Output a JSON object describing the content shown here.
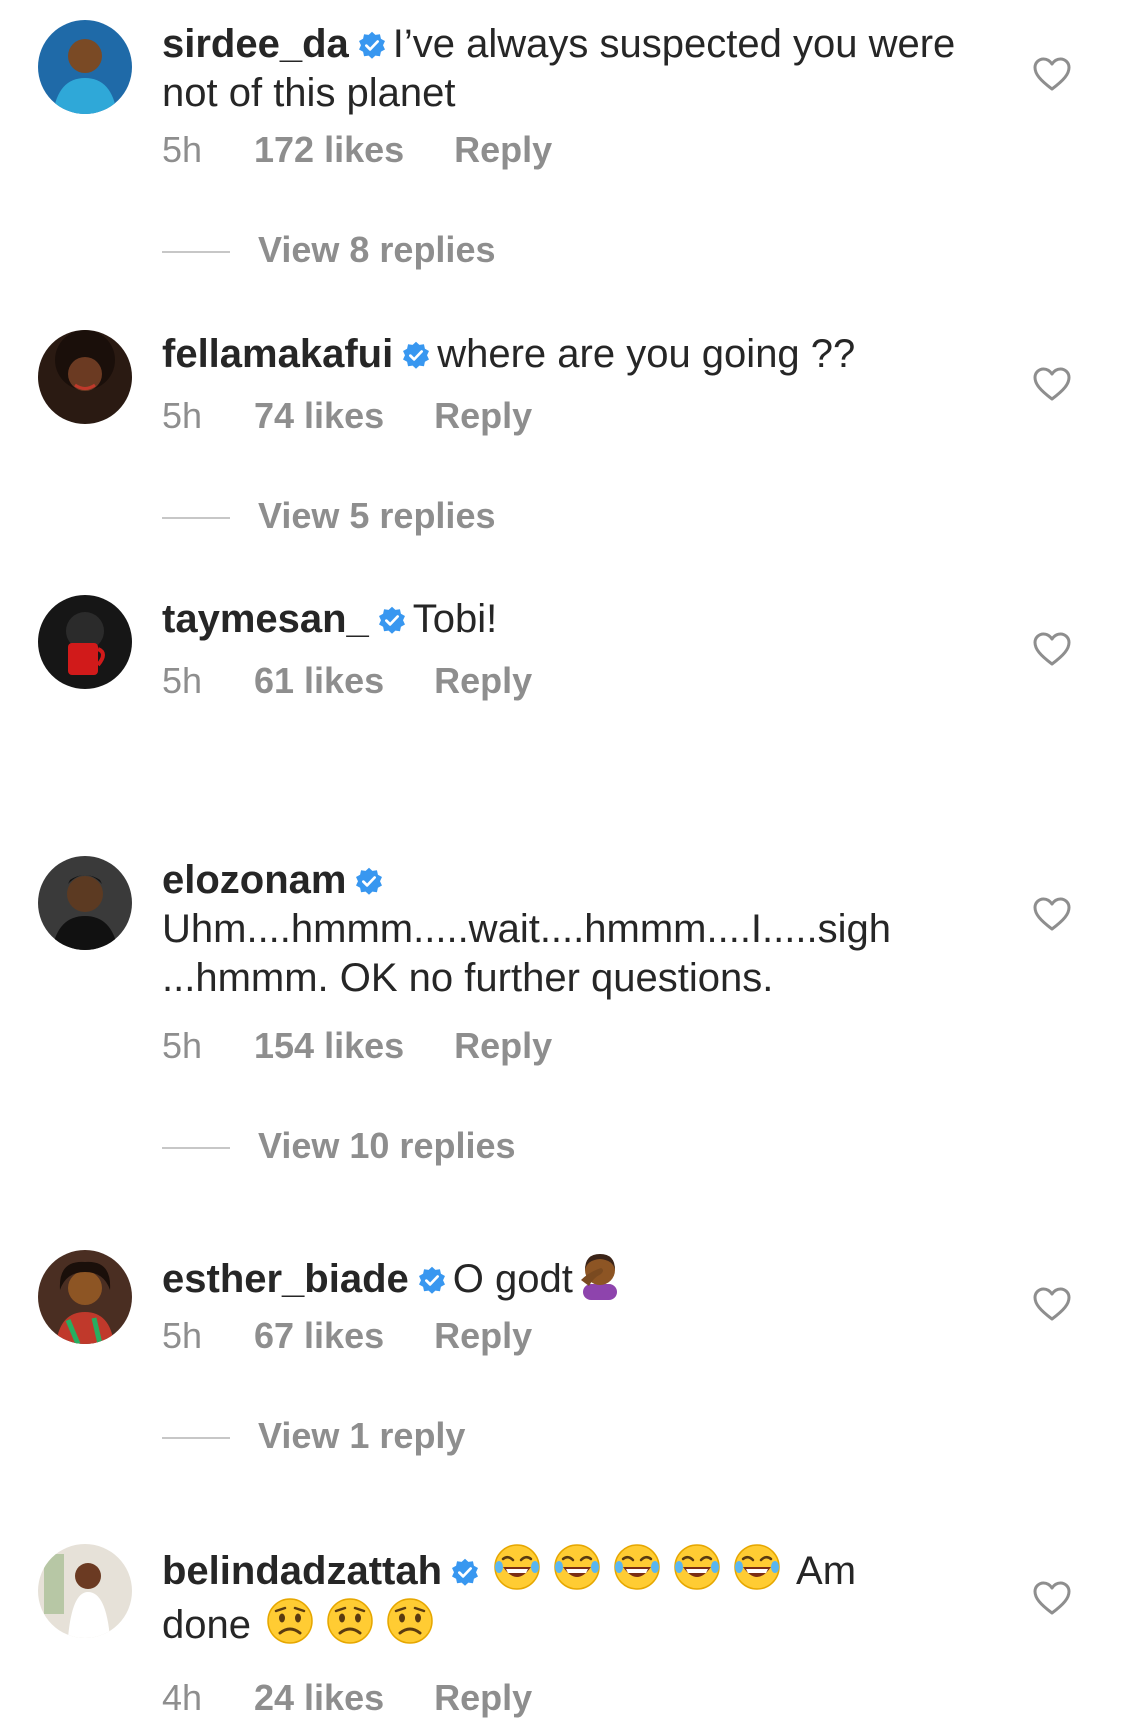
{
  "comments": [
    {
      "username": "sirdee_da",
      "text": "I’ve always suspected you were not of this planet",
      "time": "5h",
      "likes": "172 likes",
      "reply": "Reply",
      "view_replies": "View 8 replies",
      "avatar_color": "#1f6aa8"
    },
    {
      "username": "fellamakafui",
      "text": "where are you going ??",
      "time": "5h",
      "likes": "74 likes",
      "reply": "Reply",
      "view_replies": "View 5 replies",
      "avatar_color": "#3b2418"
    },
    {
      "username": "taymesan_",
      "text": "Tobi!",
      "time": "5h",
      "likes": "61 likes",
      "reply": "Reply",
      "avatar_color": "#1c1c1c"
    },
    {
      "username": "elozonam",
      "text": "Uhm....hmmm.....wait....hmmm....I.....sigh ...hmmm. OK no further questions.",
      "time": "5h",
      "likes": "154 likes",
      "reply": "Reply",
      "view_replies": "View 10 replies",
      "avatar_color": "#4a4a4a"
    },
    {
      "username": "esther_biade",
      "text": "O godt",
      "emoji_after": "woman-facepalming",
      "time": "5h",
      "likes": "67 likes",
      "reply": "Reply",
      "view_replies": "View 1 reply",
      "avatar_color": "#5a3a2e"
    },
    {
      "username": "belindadzattah",
      "text_after_laughs": "Am",
      "text_line2": "done",
      "emoji_laughs": "face-with-tears-of-joy x5",
      "emoji_worried": "worried-face x3",
      "time": "4h",
      "likes": "24 likes",
      "reply": "Reply",
      "avatar_color": "#d9d4cc"
    }
  ],
  "colors": {
    "username": "#262626",
    "meta": "#8e8e8e",
    "verified": "#3897f0",
    "divider": "#c7c7c7"
  },
  "icons": {
    "verified": "verified-badge-icon",
    "like": "heart-outline-icon"
  }
}
